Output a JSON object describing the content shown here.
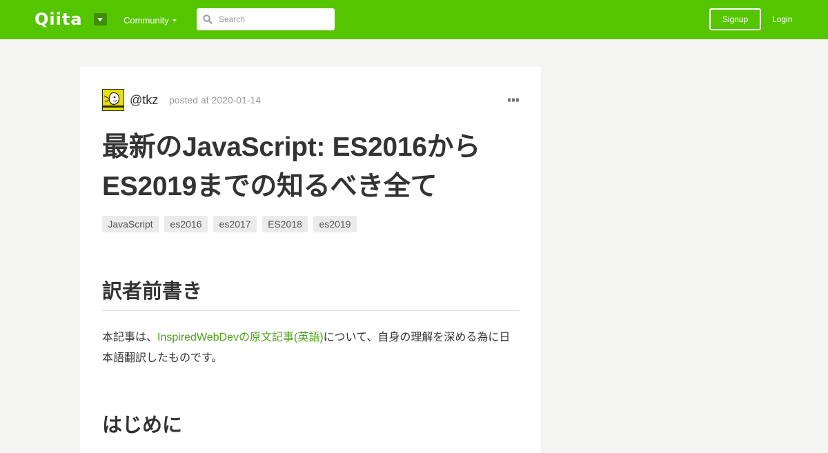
{
  "header": {
    "logo": "Qiita",
    "community_label": "Community",
    "search_placeholder": "Search",
    "search_value": "",
    "signup_label": "Signup",
    "login_label": "Login",
    "brand_color": "#55c500"
  },
  "article": {
    "author": "@tkz",
    "posted": "posted at 2020-01-14",
    "title_line1": "最新のJavaScript: ES2016から",
    "title_line2": "ES2019までの知るべき全て",
    "tags": [
      "JavaScript",
      "es2016",
      "es2017",
      "ES2018",
      "es2019"
    ],
    "section1_heading": "訳者前書き",
    "para_prefix": "本記事は、",
    "para_link": "InspiredWebDevの原文記事(英語)",
    "para_line1_suffix": "について、自身の理解を深める為に日",
    "para_line2": "本語翻訳したものです。",
    "section2_heading": "はじめに",
    "link_color": "#4aa315"
  }
}
